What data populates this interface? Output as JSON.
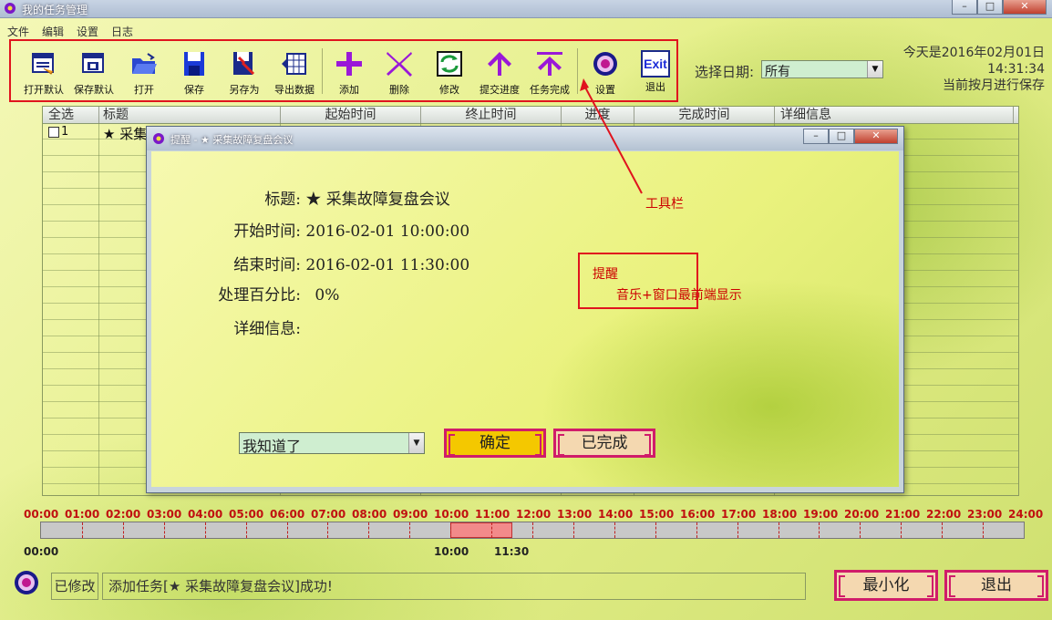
{
  "window": {
    "title": "我的任务管理",
    "min": "–",
    "max": "□",
    "close": "✕"
  },
  "menu": [
    "文件",
    "编辑",
    "设置",
    "日志"
  ],
  "toolbar": [
    {
      "label": "打开默认",
      "icon": "open-default-icon"
    },
    {
      "label": "保存默认",
      "icon": "save-default-icon"
    },
    {
      "label": "打开",
      "icon": "folder-open-icon"
    },
    {
      "label": "保存",
      "icon": "floppy-disk-icon"
    },
    {
      "label": "另存为",
      "icon": "save-as-icon"
    },
    {
      "label": "导出数据",
      "icon": "export-data-icon"
    },
    {
      "label": "添加",
      "icon": "plus-icon"
    },
    {
      "label": "删除",
      "icon": "x-icon"
    },
    {
      "label": "修改",
      "icon": "refresh-icon"
    },
    {
      "label": "提交进度",
      "icon": "arrow-up-icon"
    },
    {
      "label": "任务完成",
      "icon": "arrow-up-bar-icon"
    },
    {
      "label": "设置",
      "icon": "gear-icon"
    },
    {
      "label": "退出",
      "icon": "exit-icon",
      "icon_text": "Exit"
    }
  ],
  "date_filter": {
    "label": "选择日期:",
    "value": "所有"
  },
  "info": {
    "today": "今天是2016年02月01日",
    "time": "14:31:34",
    "save_mode": "当前按月进行保存"
  },
  "table": {
    "columns": [
      "全选",
      "标题",
      "起始时间",
      "终止时间",
      "进度",
      "完成时间",
      "详细信息"
    ],
    "rows": [
      {
        "index": "1",
        "title": "★ 采集"
      }
    ]
  },
  "dialog": {
    "title": "提醒 - ★ 采集故障复盘会议",
    "min": "–",
    "max": "□",
    "close": "✕",
    "fields": [
      {
        "label": "标题:",
        "value": "★ 采集故障复盘会议"
      },
      {
        "label": "开始时间:",
        "value": "2016-02-01 10:00:00"
      },
      {
        "label": "结束时间:",
        "value": "2016-02-01 11:30:00"
      },
      {
        "label": "处理百分比:",
        "value": "0%"
      },
      {
        "label": "详细信息:",
        "value": ""
      }
    ],
    "dismiss_select": "我知道了",
    "ok_button": "确定",
    "done_button": "已完成"
  },
  "annotations": {
    "toolbar": "工具栏",
    "reminder_title": "提醒",
    "reminder_desc": "音乐+窗口最前端显示"
  },
  "timeline": {
    "hours": [
      "00:00",
      "01:00",
      "02:00",
      "03:00",
      "04:00",
      "05:00",
      "06:00",
      "07:00",
      "08:00",
      "09:00",
      "10:00",
      "11:00",
      "12:00",
      "13:00",
      "14:00",
      "15:00",
      "16:00",
      "17:00",
      "18:00",
      "19:00",
      "20:00",
      "21:00",
      "22:00",
      "23:00",
      "24:00"
    ],
    "start_label": "00:00",
    "task_start": "10:00",
    "task_end": "11:30",
    "task_start_hours": 10,
    "task_end_hours": 11.5
  },
  "status": {
    "modified": "已修改",
    "message": "添加任务[★ 采集故障复盘会议]成功!"
  },
  "buttons": {
    "minimize": "最小化",
    "exit": "退出"
  },
  "colors": {
    "accent_red": "#e0141e",
    "icon_purple": "#8a10c8",
    "icon_blue": "#1a2a8a",
    "button_yellow": "#f4c800",
    "button_pink": "#f4d0b8"
  }
}
